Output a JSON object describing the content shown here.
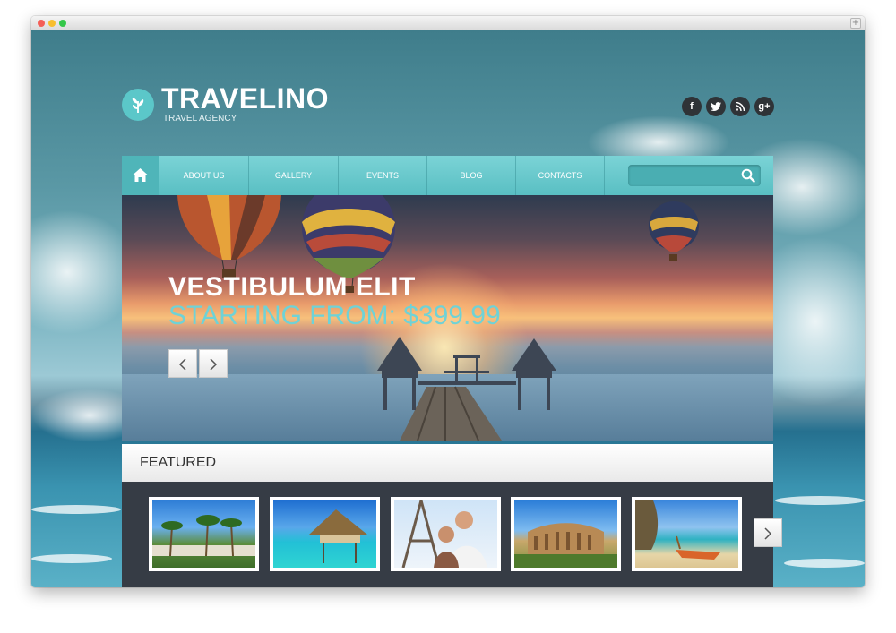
{
  "brand": {
    "name": "TRAVELINO",
    "tagline": "TRAVEL AGENCY",
    "logo_icon": "leaf-icon"
  },
  "social": [
    {
      "name": "facebook",
      "glyph": "f"
    },
    {
      "name": "twitter",
      "glyph": "t"
    },
    {
      "name": "rss",
      "glyph": "rss"
    },
    {
      "name": "google-plus",
      "glyph": "g+"
    }
  ],
  "nav": {
    "home_icon": "home-icon",
    "items": [
      "ABOUT US",
      "GALLERY",
      "EVENTS",
      "BLOG",
      "CONTACTS"
    ],
    "search": {
      "value": "",
      "icon": "search-icon"
    }
  },
  "slider": {
    "title": "VESTIBULUM ELIT",
    "subtitle": "STARTING FROM: $399.99",
    "prev_icon": "chevron-left-icon",
    "next_icon": "chevron-right-icon"
  },
  "featured": {
    "title": "FEATURED",
    "thumbnails": [
      "palm-resort-photo",
      "overwater-bungalow-photo",
      "couple-eiffel-tower-photo",
      "colosseum-photo",
      "beach-longtail-boat-photo"
    ],
    "next_icon": "chevron-right-icon"
  },
  "colors": {
    "accent": "#5bc7c9",
    "nav": "#59bfc3",
    "subtitle": "#6fd2d6",
    "featured_panel": "#363c45",
    "social": "#2f3337"
  }
}
